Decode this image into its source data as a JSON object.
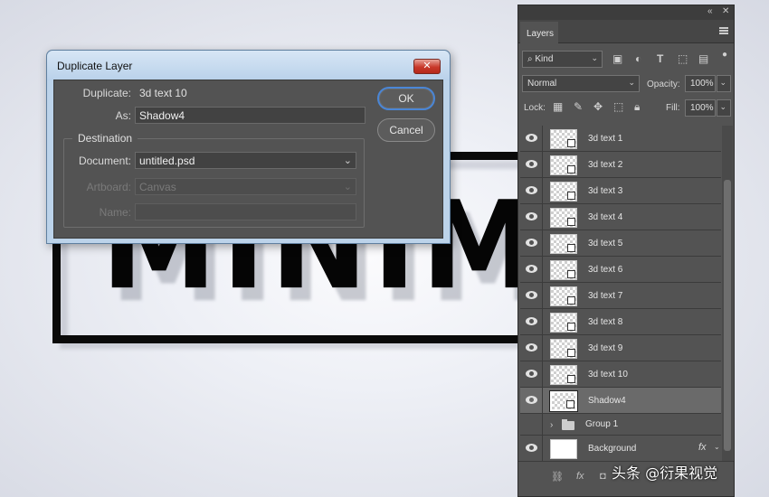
{
  "canvas": {
    "artwork_text": "MINIMA"
  },
  "dialog": {
    "title": "Duplicate Layer",
    "close_icon": "close-icon",
    "duplicate_label": "Duplicate:",
    "duplicate_value": "3d text 10",
    "as_label": "As:",
    "as_value": "Shadow4",
    "destination_legend": "Destination",
    "document_label": "Document:",
    "document_value": "untitled.psd",
    "artboard_label": "Artboard:",
    "artboard_value": "Canvas",
    "name_label": "Name:",
    "name_value": "",
    "ok_label": "OK",
    "cancel_label": "Cancel"
  },
  "panel": {
    "tab_label": "Layers",
    "filter_kind": "Kind",
    "blend_mode": "Normal",
    "opacity_label": "Opacity:",
    "opacity_value": "100%",
    "lock_label": "Lock:",
    "fill_label": "Fill:",
    "fill_value": "100%",
    "layers": [
      {
        "name": "3d text 1"
      },
      {
        "name": "3d text 2"
      },
      {
        "name": "3d text 3"
      },
      {
        "name": "3d text 4"
      },
      {
        "name": "3d text 5"
      },
      {
        "name": "3d text 6"
      },
      {
        "name": "3d text 7"
      },
      {
        "name": "3d text 8"
      },
      {
        "name": "3d text 9"
      },
      {
        "name": "3d text 10"
      },
      {
        "name": "Shadow4",
        "selected": true
      },
      {
        "name": "Group 1",
        "type": "group"
      },
      {
        "name": "Background",
        "type": "background",
        "fx": "fx"
      }
    ],
    "footer": {
      "link": "⛓",
      "fx": "fx",
      "mask": "◘"
    }
  },
  "watermark": "头条 @衍果视觉",
  "colors": {
    "panel_bg": "#535353",
    "dialog_chrome": "#bcd3ea",
    "selected_row": "#6a6a6a",
    "ok_focus": "#4a86d6",
    "close_button": "#c8392b"
  }
}
